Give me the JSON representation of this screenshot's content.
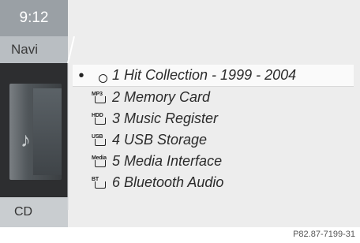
{
  "status": {
    "time": "9:12"
  },
  "left_menu": {
    "navi_label": "Navi",
    "cd_label": "CD"
  },
  "media_list": [
    {
      "icon": "disc-icon",
      "icon_text": "",
      "label": "1 Hit Collection - 1999 - 2004",
      "selected": true
    },
    {
      "icon": "mp3-card-icon",
      "icon_text": "MP3",
      "label": "2 Memory Card",
      "selected": false
    },
    {
      "icon": "hdd-icon",
      "icon_text": "HDD",
      "label": "3 Music Register",
      "selected": false
    },
    {
      "icon": "usb-icon",
      "icon_text": "USB",
      "label": "4 USB Storage",
      "selected": false
    },
    {
      "icon": "media-interface-icon",
      "icon_text": "Media",
      "label": "5 Media Interface",
      "selected": false
    },
    {
      "icon": "bluetooth-audio-icon",
      "icon_text": "BT",
      "label": "6 Bluetooth Audio",
      "selected": false
    }
  ],
  "figure_ref": "P82.87-7199-31"
}
